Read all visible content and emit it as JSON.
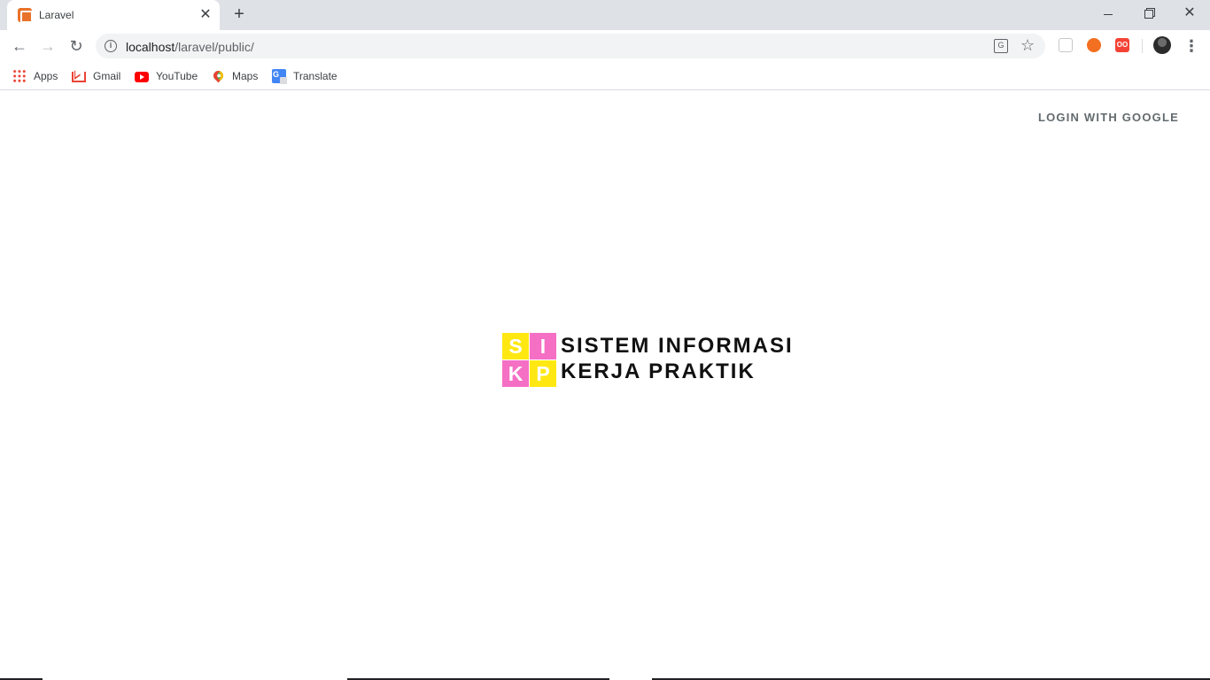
{
  "browser": {
    "tab_title": "Laravel",
    "new_tab_symbol": "+",
    "url_host": "localhost",
    "url_path": "/laravel/public/",
    "bookmarks": [
      {
        "label": "Apps",
        "icon": "apps-grid-icon"
      },
      {
        "label": "Gmail",
        "icon": "gmail-icon"
      },
      {
        "label": "YouTube",
        "icon": "youtube-icon"
      },
      {
        "label": "Maps",
        "icon": "maps-pin-icon"
      },
      {
        "label": "Translate",
        "icon": "google-translate-icon"
      }
    ],
    "extensions": {
      "ext3_label": "OO"
    }
  },
  "page": {
    "login_label": "LOGIN WITH GOOGLE",
    "logo": {
      "cells": [
        "S",
        "I",
        "K",
        "P"
      ],
      "line1": "SISTEM INFORMASI",
      "line2": "KERJA PRAKTIK",
      "colors": {
        "yellow": "#ffe812",
        "pink": "#f56fc4"
      }
    }
  }
}
